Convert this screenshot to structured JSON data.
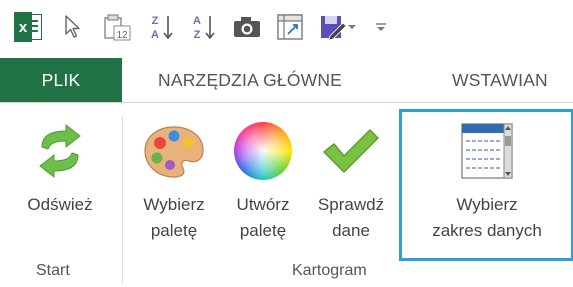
{
  "quick_access": {
    "app_icon": "excel-icon",
    "app_letter": "x",
    "icons": [
      "cursor-select-icon",
      "form-icon",
      "sort-ascending-icon",
      "sort-descending-icon",
      "camera-icon",
      "pivot-table-icon",
      "save-edit-icon",
      "dropdown-arrow-icon",
      "customize-toolbar-icon"
    ],
    "form_number": "12",
    "sort_az": "A Z",
    "sort_za": "Z A"
  },
  "tabs": [
    {
      "label": "PLIK",
      "active": true
    },
    {
      "label": "NARZĘDZIA GŁÓWNE",
      "active": false
    },
    {
      "label": "WSTAWIAN",
      "active": false
    }
  ],
  "ribbon": {
    "groups": [
      {
        "label": "Start"
      },
      {
        "label": "Kartogram"
      }
    ],
    "buttons": [
      {
        "label": "Odśwież",
        "icon": "refresh-icon"
      },
      {
        "label": "Wybierz paletę",
        "line1": "Wybierz",
        "line2": "paletę",
        "icon": "palette-icon"
      },
      {
        "label": "Utwórz paletę",
        "line1": "Utwórz",
        "line2": "paletę",
        "icon": "color-wheel-icon"
      },
      {
        "label": "Sprawdź dane",
        "line1": "Sprawdź",
        "line2": "dane",
        "icon": "checkmark-icon"
      },
      {
        "label": "Wybierz zakres danych",
        "line1": "Wybierz",
        "line2": "zakres danych",
        "icon": "data-range-icon",
        "highlighted": true
      }
    ]
  },
  "colors": {
    "excel_green": "#217346",
    "highlight_blue": "#2d9fd6",
    "refresh_green": "#6cc04a",
    "check_green": "#7cc242"
  }
}
